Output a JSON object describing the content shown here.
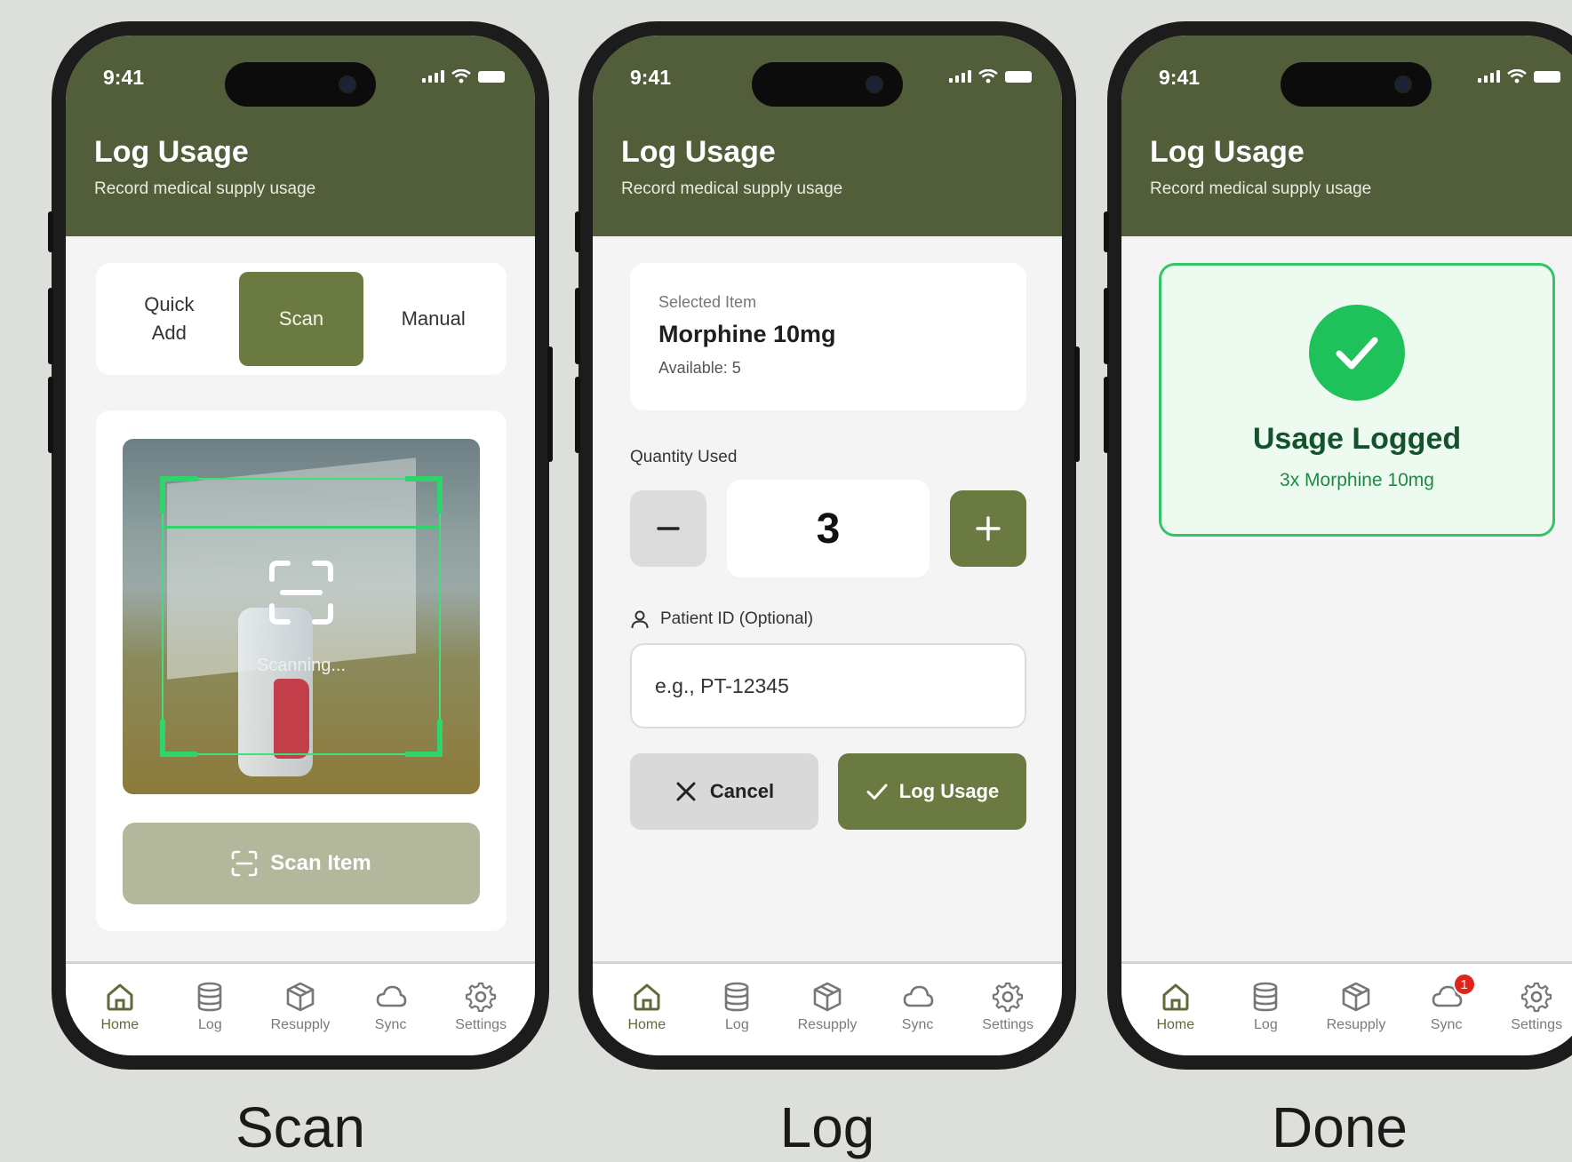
{
  "status": {
    "time": "9:41"
  },
  "header": {
    "title": "Log Usage",
    "subtitle": "Record medical supply usage"
  },
  "nav": {
    "items": [
      {
        "label": "Home",
        "icon": "home-icon"
      },
      {
        "label": "Log",
        "icon": "database-icon"
      },
      {
        "label": "Resupply",
        "icon": "package-icon"
      },
      {
        "label": "Sync",
        "icon": "cloud-icon"
      },
      {
        "label": "Settings",
        "icon": "gear-icon"
      }
    ],
    "sync_badge": "1"
  },
  "scan_screen": {
    "tabs": [
      "Quick Add",
      "Scan",
      "Manual"
    ],
    "active_tab": "Scan",
    "scanning_text": "Scanning...",
    "scan_button": "Scan Item"
  },
  "log_screen": {
    "selected_label": "Selected Item",
    "selected_name": "Morphine 10mg",
    "available": "Available: 5",
    "quantity_label": "Quantity Used",
    "quantity_minus": "−",
    "quantity": "3",
    "quantity_plus": "+",
    "patient_label": "Patient ID (Optional)",
    "patient_placeholder": "e.g., PT-12345",
    "cancel_label": "Cancel",
    "log_label": "Log Usage"
  },
  "done_screen": {
    "title": "Usage Logged",
    "subtitle": "3x Morphine 10mg"
  },
  "captions": [
    "Scan",
    "Log",
    "Done"
  ],
  "colors": {
    "header": "#525d39",
    "accent": "#6b7a41",
    "success": "#1fc25a"
  }
}
